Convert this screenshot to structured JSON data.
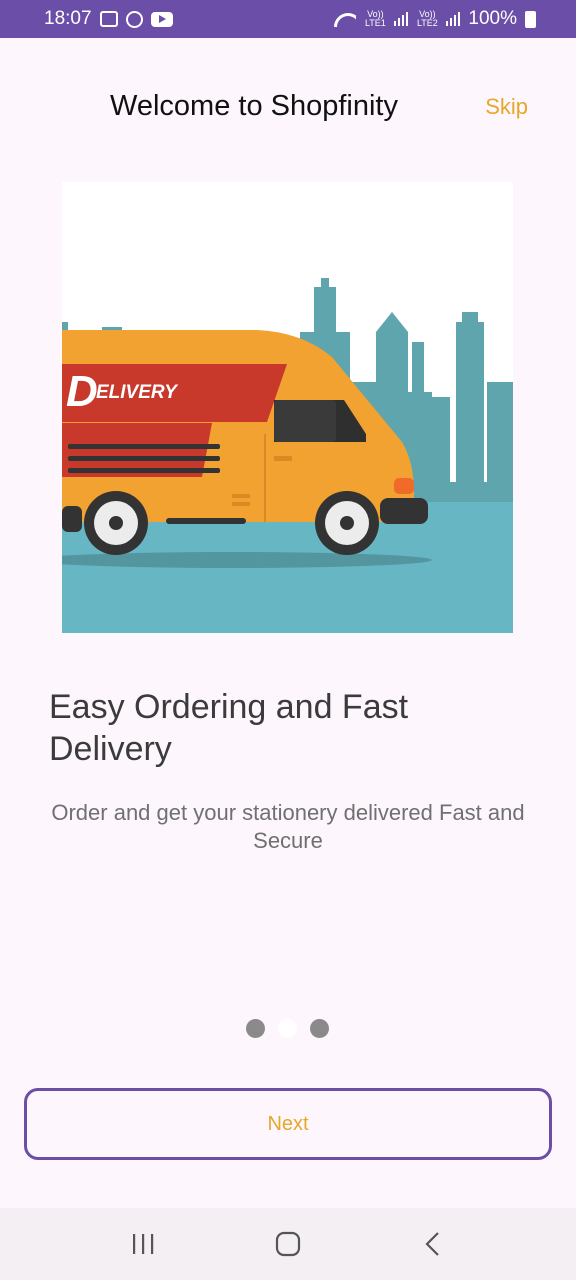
{
  "status_bar": {
    "time": "18:07",
    "sim1_label": "Vo)) LTE1",
    "sim2_label": "Vo)) LTE2",
    "battery": "100%"
  },
  "header": {
    "title": "Welcome to Shopfinity",
    "skip_label": "Skip"
  },
  "illustration": {
    "van_text": "ELIVERY",
    "van_logo_letter": "D"
  },
  "content": {
    "headline": "Easy Ordering and Fast Delivery",
    "subtitle": "Order and get your stationery delivered Fast and Secure"
  },
  "pager": {
    "total": 3,
    "current": 2
  },
  "actions": {
    "next_label": "Next"
  },
  "colors": {
    "accent": "#e6a72a",
    "primary": "#6a4ea8",
    "background": "#fdf7fd"
  },
  "nav_bar": {
    "items": [
      "recent-apps-icon",
      "home-icon",
      "back-icon"
    ]
  }
}
